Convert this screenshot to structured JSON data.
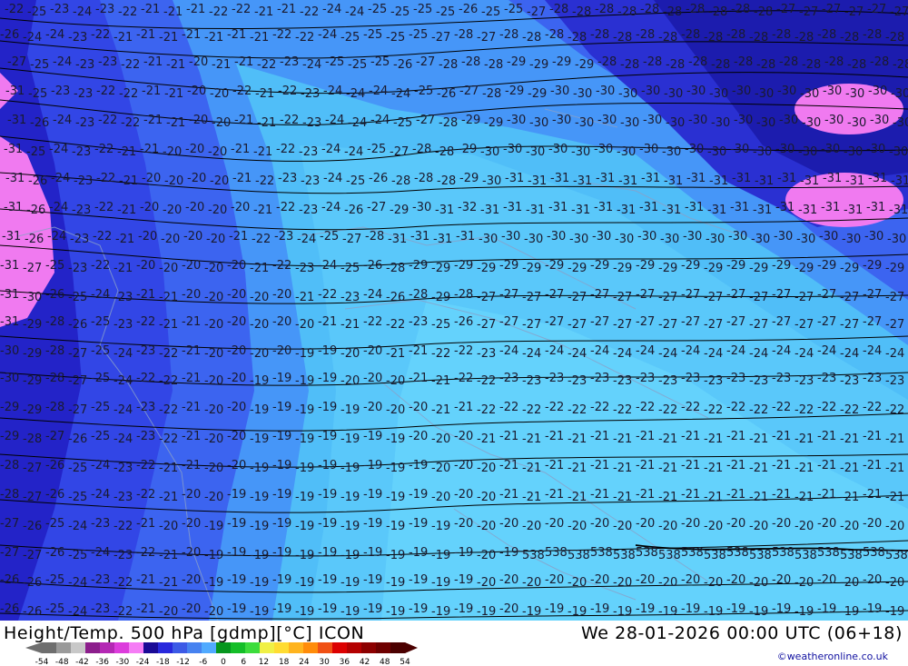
{
  "map": {
    "product_title": "Height/Temp. 500 hPa [gdmp][°C] ICON",
    "valid_time": "We 28-01-2026 00:00 UTC (06+18)",
    "credit": "©weatheronline.co.uk",
    "contour_labels": [
      "-19",
      "-20",
      "-21",
      "-22",
      "-23",
      "-24",
      "-25",
      "-26",
      "-27",
      "-28",
      "-29",
      "-30",
      "-31",
      "-32",
      "538"
    ],
    "scale": {
      "ticks": [
        "-54",
        "-48",
        "-42",
        "-36",
        "-30",
        "-24",
        "-18",
        "-12",
        "-6",
        "0",
        "6",
        "12",
        "18",
        "24",
        "30",
        "36",
        "42",
        "48",
        "54"
      ],
      "colors": [
        "#6e6e6e",
        "#9a9a9a",
        "#c8c8c8",
        "#8c1e8c",
        "#b428b4",
        "#dc3cdc",
        "#f57df5",
        "#1a0a96",
        "#2828dc",
        "#3c5ae6",
        "#4682f0",
        "#50aaff",
        "#06961e",
        "#14be28",
        "#3cdc3c",
        "#f0f046",
        "#ffdc32",
        "#ffb41e",
        "#ff8c0a",
        "#f05014",
        "#dc0000",
        "#b40000",
        "#8c0000",
        "#6e0000",
        "#4b0000"
      ],
      "unit": "°C"
    }
  }
}
